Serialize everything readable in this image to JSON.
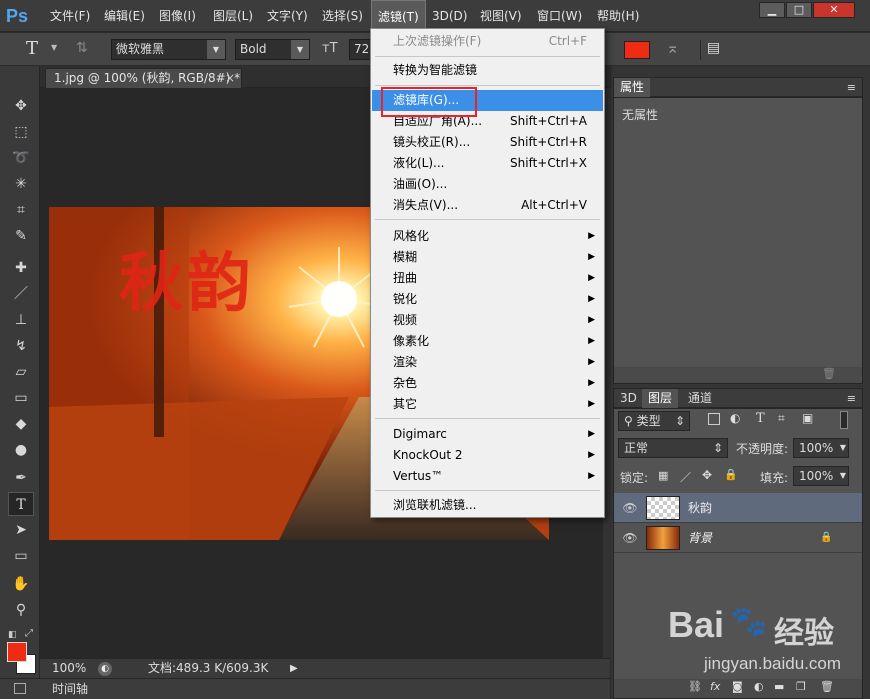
{
  "menubar": {
    "logo": "Ps",
    "items": [
      "文件(F)",
      "编辑(E)",
      "图像(I)",
      "图层(L)",
      "文字(Y)",
      "选择(S)",
      "滤镜(T)",
      "3D(D)",
      "视图(V)",
      "窗口(W)",
      "帮助(H)"
    ],
    "window_controls": [
      "▁",
      "□",
      "✕"
    ]
  },
  "options": {
    "font_family": "微软雅黑",
    "font_style": "Bold",
    "font_size": "72",
    "color_swatch": "#ef2b14"
  },
  "document": {
    "tab_title": "1.jpg @ 100% (秋韵, RGB/8#) *",
    "tab_close": "×",
    "photo_text": "秋韵"
  },
  "status": {
    "zoom": "100%",
    "doc_info": "文档:489.3 K/609.3K",
    "timeline": "时间轴"
  },
  "properties_panel": {
    "tab": "属性",
    "body": "无属性"
  },
  "layers_panel": {
    "tabs": [
      "3D",
      "图层",
      "通道"
    ],
    "filter_kind": "类型",
    "blend_mode": "正常",
    "opacity_label": "不透明度:",
    "opacity_value": "100%",
    "lock_label": "锁定:",
    "fill_label": "填充:",
    "fill_value": "100%",
    "layers": [
      {
        "name": "秋韵"
      },
      {
        "name": "背景"
      }
    ]
  },
  "filter_menu": {
    "items": [
      {
        "label": "上次滤镜操作(F)",
        "shortcut": "Ctrl+F"
      },
      {
        "label": "转换为智能滤镜"
      },
      {
        "label": "滤镜库(G)..."
      },
      {
        "label": "自适应广角(A)...",
        "shortcut": "Shift+Ctrl+A"
      },
      {
        "label": "镜头校正(R)...",
        "shortcut": "Shift+Ctrl+R"
      },
      {
        "label": "液化(L)...",
        "shortcut": "Shift+Ctrl+X"
      },
      {
        "label": "油画(O)..."
      },
      {
        "label": "消失点(V)...",
        "shortcut": "Alt+Ctrl+V"
      },
      {
        "label": "风格化"
      },
      {
        "label": "模糊"
      },
      {
        "label": "扭曲"
      },
      {
        "label": "锐化"
      },
      {
        "label": "视频"
      },
      {
        "label": "像素化"
      },
      {
        "label": "渲染"
      },
      {
        "label": "杂色"
      },
      {
        "label": "其它"
      },
      {
        "label": "Digimarc"
      },
      {
        "label": "KnockOut 2"
      },
      {
        "label": "Vertus™"
      },
      {
        "label": "浏览联机滤镜..."
      }
    ]
  },
  "watermark": {
    "brand": "Bai",
    "brand2": "经验",
    "url": "jingyan.baidu.com"
  }
}
